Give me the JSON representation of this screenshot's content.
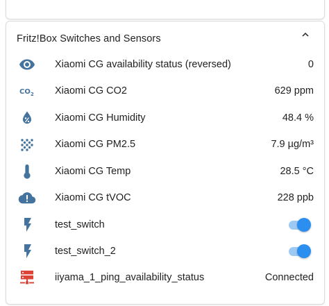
{
  "card": {
    "title": "Fritz!Box Switches and Sensors",
    "collapse_icon": "chevron-up-icon"
  },
  "colors": {
    "icon_blue": "#44739e",
    "icon_red": "#db4437",
    "toggle_on": "#2c8ff0"
  },
  "entities": [
    {
      "icon": "eye-icon",
      "label": "Xiaomi CG availability status (reversed)",
      "value": "0"
    },
    {
      "icon": "co2-icon",
      "label": "Xiaomi CG CO2",
      "value": "629 ppm"
    },
    {
      "icon": "humidity-percent-icon",
      "label": "Xiaomi CG Humidity",
      "value": "48.4 %"
    },
    {
      "icon": "pm25-dots-icon",
      "label": "Xiaomi CG PM2.5",
      "value": "7.9 µg/m³"
    },
    {
      "icon": "thermometer-icon",
      "label": "Xiaomi CG Temp",
      "value": "28.5 °C"
    },
    {
      "icon": "cloud-alert-icon",
      "label": "Xiaomi CG tVOC",
      "value": "228 ppb"
    },
    {
      "icon": "flash-icon",
      "label": "test_switch",
      "state": "on"
    },
    {
      "icon": "flash-icon",
      "label": "test_switch_2",
      "state": "on"
    },
    {
      "icon": "server-network-icon",
      "label": "iiyama_1_ping_availability_status",
      "value": "Connected"
    }
  ]
}
